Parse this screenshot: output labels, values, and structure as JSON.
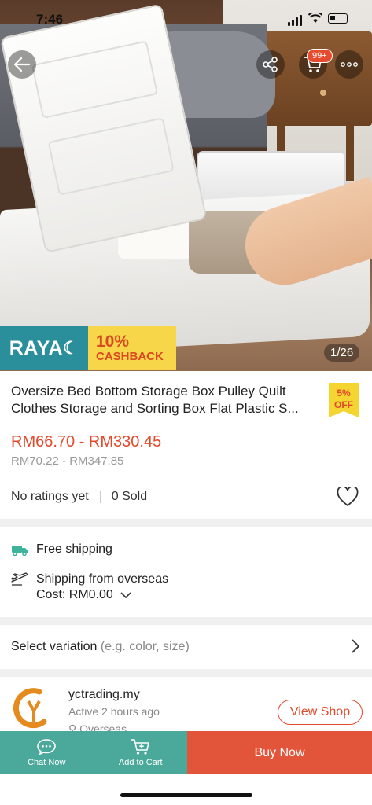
{
  "status_bar": {
    "time": "7:46"
  },
  "header": {
    "cart_badge": "99+"
  },
  "hero": {
    "promo_brand": "RAYA",
    "promo_percent": "10%",
    "promo_label": "CASHBACK",
    "image_counter": "1/26"
  },
  "product": {
    "title": "Oversize Bed Bottom Storage Box Pulley Quilt Clothes Storage and Sorting Box Flat Plastic S...",
    "discount_badge_pct": "5%",
    "discount_badge_label": "OFF",
    "price_range": "RM66.70 - RM330.45",
    "original_price_range": "RM70.22 - RM347.85",
    "ratings": "No ratings yet",
    "sold": "0 Sold"
  },
  "shipping": {
    "free_shipping": "Free shipping",
    "ship_from_prefix": "Shipping from ",
    "ship_from_place": "overseas",
    "cost": "Cost: RM0.00"
  },
  "variation": {
    "label": "Select variation",
    "hint": "(e.g. color, size)"
  },
  "shop": {
    "name": "yctrading.my",
    "active": "Active 2 hours ago",
    "location": "Overseas",
    "view_shop": "View Shop"
  },
  "bottom_bar": {
    "chat": "Chat Now",
    "add_to_cart": "Add to Cart",
    "buy_now": "Buy Now"
  },
  "colors": {
    "accent": "#e2492a",
    "teal": "#4aa99a",
    "buy_now_bg": "#e2553b",
    "promo_yellow": "#f7d64a",
    "promo_teal": "#2a8f9b"
  }
}
